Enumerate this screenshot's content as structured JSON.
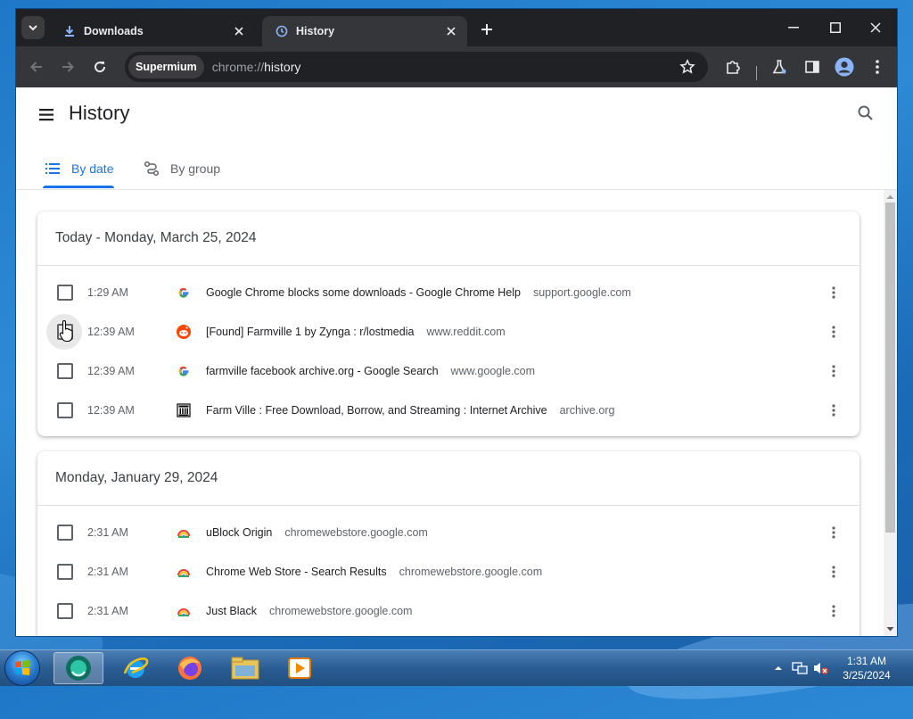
{
  "browser": {
    "tabs": [
      {
        "title": "Downloads",
        "icon": "download-icon",
        "active": false
      },
      {
        "title": "History",
        "icon": "history-icon",
        "active": true
      }
    ],
    "omnibox": {
      "origin_chip": "Supermium",
      "url_scheme": "chrome://",
      "url_path": "history"
    }
  },
  "page": {
    "title": "History",
    "tabs": [
      {
        "label": "By date",
        "active": true
      },
      {
        "label": "By group",
        "active": false
      }
    ]
  },
  "groups": [
    {
      "heading": "Today - Monday, March 25, 2024",
      "entries": [
        {
          "time": "1:29 AM",
          "favicon": "google-favicon",
          "title": "Google Chrome blocks some downloads - Google Chrome Help",
          "domain": "support.google.com"
        },
        {
          "time": "12:39 AM",
          "favicon": "reddit-favicon",
          "title": "[Found] Farmville 1 by Zynga : r/lostmedia",
          "domain": "www.reddit.com"
        },
        {
          "time": "12:39 AM",
          "favicon": "google-favicon",
          "title": "farmville facebook archive.org - Google Search",
          "domain": "www.google.com"
        },
        {
          "time": "12:39 AM",
          "favicon": "archive-favicon",
          "title": "Farm Ville : Free Download, Borrow, and Streaming : Internet Archive",
          "domain": "archive.org"
        }
      ]
    },
    {
      "heading": "Monday, January 29, 2024",
      "entries": [
        {
          "time": "2:31 AM",
          "favicon": "webstore-favicon",
          "title": "uBlock Origin",
          "domain": "chromewebstore.google.com"
        },
        {
          "time": "2:31 AM",
          "favicon": "webstore-favicon",
          "title": "Chrome Web Store - Search Results",
          "domain": "chromewebstore.google.com"
        },
        {
          "time": "2:31 AM",
          "favicon": "webstore-favicon",
          "title": "Just Black",
          "domain": "chromewebstore.google.com"
        }
      ]
    }
  ],
  "taskbar": {
    "apps": [
      "supermium-app",
      "internet-explorer-app",
      "firefox-app",
      "file-explorer-app",
      "media-player-app"
    ],
    "clock_time": "1:31 AM",
    "clock_date": "3/25/2024"
  },
  "colors": {
    "accent": "#1a73e8",
    "titlebar": "#202124",
    "toolbar": "#35363a"
  }
}
